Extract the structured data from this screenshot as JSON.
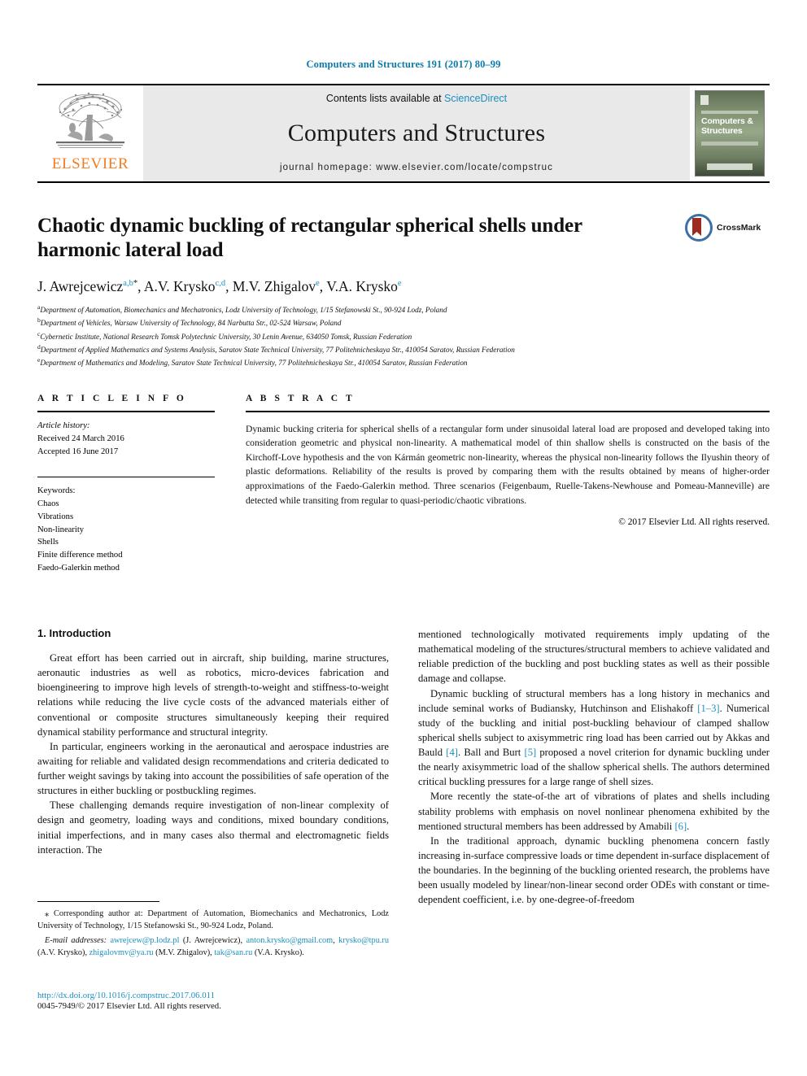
{
  "running_head": "Computers and Structures 191 (2017) 80–99",
  "masthead": {
    "publisher_wordmark": "ELSEVIER",
    "contents_prefix": "Contents lists available at ",
    "contents_link": "ScienceDirect",
    "journal_name": "Computers and Structures",
    "homepage": "journal homepage: www.elsevier.com/locate/compstruc",
    "cover_title": "Computers & Structures"
  },
  "article": {
    "title": "Chaotic dynamic buckling of rectangular spherical shells under harmonic lateral load",
    "crossmark_label": "CrossMark",
    "authors": [
      {
        "name": "J. Awrejcewicz",
        "marks": "a,b",
        "star": "*",
        "sep": ", "
      },
      {
        "name": "A.V. Krysko",
        "marks": "c,d",
        "star": "",
        "sep": ", "
      },
      {
        "name": "M.V. Zhigalov",
        "marks": "e",
        "star": "",
        "sep": ", "
      },
      {
        "name": "V.A. Krysko",
        "marks": "e",
        "star": "",
        "sep": ""
      }
    ],
    "affiliations": [
      {
        "key": "a",
        "text": "Department of Automation, Biomechanics and Mechatronics, Lodz University of Technology, 1/15 Stefanowski St., 90-924 Lodz, Poland"
      },
      {
        "key": "b",
        "text": "Department of Vehicles, Warsaw University of Technology, 84 Narbutta Str., 02-524 Warsaw, Poland"
      },
      {
        "key": "c",
        "text": "Cybernetic Institute, National Research Tomsk Polytechnic University, 30 Lenin Avenue, 634050 Tomsk, Russian Federation"
      },
      {
        "key": "d",
        "text": "Department of Applied Mathematics and Systems Analysis, Saratov State Technical University, 77 Politehnicheskaya Str., 410054 Saratov, Russian Federation"
      },
      {
        "key": "e",
        "text": "Department of Mathematics and Modeling, Saratov State Technical University, 77 Politehnicheskaya Str., 410054 Saratov, Russian Federation"
      }
    ]
  },
  "article_info": {
    "heading": "A R T I C L E   I N F O",
    "history_label": "Article history:",
    "received": "Received 24 March 2016",
    "accepted": "Accepted 16 June 2017",
    "keywords_label": "Keywords:",
    "keywords": [
      "Chaos",
      "Vibrations",
      "Non-linearity",
      "Shells",
      "Finite difference method",
      "Faedo-Galerkin method"
    ]
  },
  "abstract": {
    "heading": "A B S T R A C T",
    "text": "Dynamic bucking criteria for spherical shells of a rectangular form under sinusoidal lateral load are proposed and developed taking into consideration geometric and physical non-linearity. A mathematical model of thin shallow shells is constructed on the basis of the Kirchoff-Love hypothesis and the von Kármán geometric non-linearity, whereas the physical non-linearity follows the Ilyushin theory of plastic deformations. Reliability of the results is proved by comparing them with the results obtained by means of higher-order approximations of the Faedo-Galerkin method. Three scenarios (Feigenbaum, Ruelle-Takens-Newhouse and Pomeau-Manneville) are detected while transiting from regular to quasi-periodic/chaotic vibrations.",
    "copyright": "© 2017 Elsevier Ltd. All rights reserved."
  },
  "body": {
    "section_title": "1. Introduction",
    "left_paragraphs": [
      "Great effort has been carried out in aircraft, ship building, marine structures, aeronautic industries as well as robotics, micro-devices fabrication and bioengineering to improve high levels of strength-to-weight and stiffness-to-weight relations while reducing the live cycle costs of the advanced materials either of conventional or composite structures simultaneously keeping their required dynamical stability performance and structural integrity.",
      "In particular, engineers working in the aeronautical and aerospace industries are awaiting for reliable and validated design recommendations and criteria dedicated to further weight savings by taking into account the possibilities of safe operation of the structures in either buckling or postbuckling regimes.",
      "These challenging demands require investigation of non-linear complexity of design and geometry, loading ways and conditions, mixed boundary conditions, initial imperfections, and in many cases also thermal and electromagnetic fields interaction. The"
    ],
    "right_paragraphs": [
      {
        "parts": [
          {
            "t": "mentioned technologically motivated requirements imply updating of the mathematical modeling of the structures/structural members to achieve validated and reliable prediction of the buckling and post buckling states as well as their possible damage and collapse.",
            "link": false
          }
        ],
        "indent": false
      },
      {
        "parts": [
          {
            "t": "Dynamic buckling of structural members has a long history in mechanics and include seminal works of Budiansky, Hutchinson and Elishakoff ",
            "link": false
          },
          {
            "t": "[1–3]",
            "link": true
          },
          {
            "t": ". Numerical study of the buckling and initial post-buckling behaviour of clamped shallow spherical shells subject to axisymmetric ring load has been carried out by Akkas and Bauld ",
            "link": false
          },
          {
            "t": "[4]",
            "link": true
          },
          {
            "t": ". Ball and Burt ",
            "link": false
          },
          {
            "t": "[5]",
            "link": true
          },
          {
            "t": " proposed a novel criterion for dynamic buckling under the nearly axisymmetric load of the shallow spherical shells. The authors determined critical buckling pressures for a large range of shell sizes.",
            "link": false
          }
        ],
        "indent": true
      },
      {
        "parts": [
          {
            "t": "More recently the state-of-the art of vibrations of plates and shells including stability problems with emphasis on novel nonlinear phenomena exhibited by the mentioned structural members has been addressed by Amabili ",
            "link": false
          },
          {
            "t": "[6]",
            "link": true
          },
          {
            "t": ".",
            "link": false
          }
        ],
        "indent": true
      },
      {
        "parts": [
          {
            "t": "In the traditional approach, dynamic buckling phenomena concern fastly increasing in-surface compressive loads or time dependent in-surface displacement of the boundaries. In the beginning of the buckling oriented research, the problems have been usually modeled by linear/non-linear second order ODEs with constant or time-dependent coefficient, i.e. by one-degree-of-freedom",
            "link": false
          }
        ],
        "indent": true
      }
    ]
  },
  "footnotes": {
    "corresponding": "⁎ Corresponding author at: Department of Automation, Biomechanics and Mechatronics, Lodz University of Technology, 1/15 Stefanowski St., 90-924 Lodz, Poland.",
    "email_label": "E-mail addresses:",
    "emails": [
      {
        "address": "awrejcew@p.lodz.pl",
        "owner": " (J. Awrejcewicz), "
      },
      {
        "address": "anton.krysko@gmail.com",
        "owner": ", "
      },
      {
        "address": "krysko@tpu.ru",
        "owner": " (A.V. Krysko), "
      },
      {
        "address": "zhigalovmv@ya.ru",
        "owner": " (M.V. Zhigalov), "
      },
      {
        "address": "tak@san.ru",
        "owner": " (V.A. Krysko)."
      }
    ]
  },
  "footer": {
    "doi": "http://dx.doi.org/10.1016/j.compstruc.2017.06.011",
    "issn": "0045-7949/© 2017 Elsevier Ltd. All rights reserved."
  },
  "colors": {
    "link": "#1a8fc1",
    "elsevier_orange": "#f47c20",
    "running_head": "#0b7bad"
  }
}
